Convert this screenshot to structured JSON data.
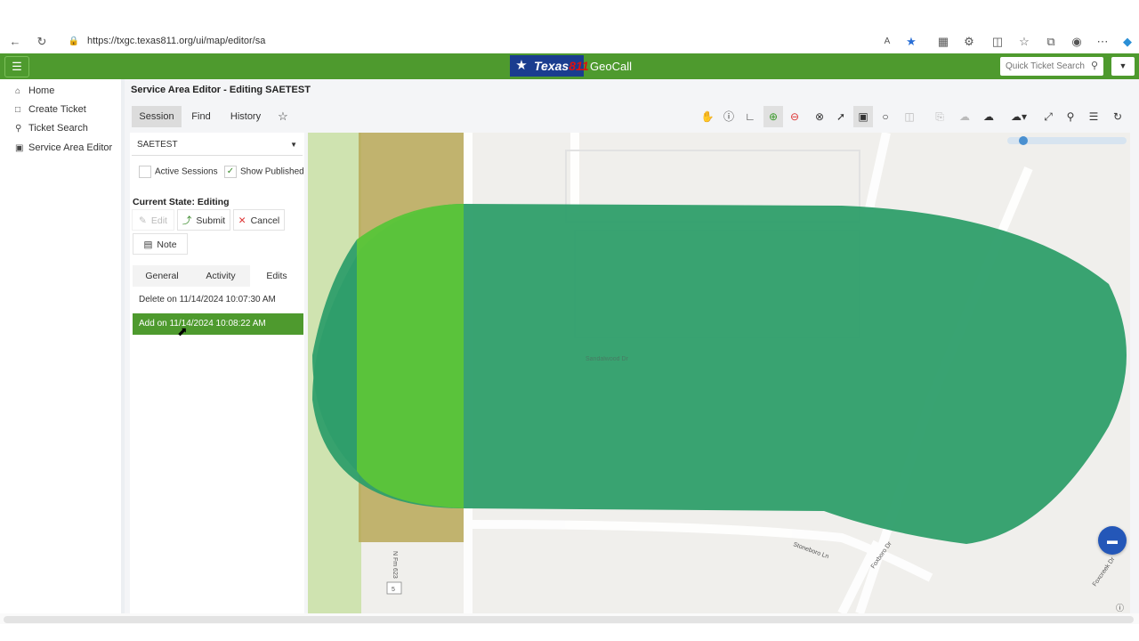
{
  "browser": {
    "url": "https://txgc.texas811.org/ui/map/editor/sa"
  },
  "app": {
    "logo_text": "Texas",
    "logo_number": "811",
    "title": "GeoCall",
    "quick_search_placeholder": "Quick Ticket Search",
    "brand_color": "#4e9a2e"
  },
  "sidebar": {
    "items": [
      {
        "label": "Home",
        "icon": "home-icon"
      },
      {
        "label": "Create Ticket",
        "icon": "document-icon"
      },
      {
        "label": "Ticket Search",
        "icon": "search-icon"
      },
      {
        "label": "Service Area Editor",
        "icon": "map-editor-icon"
      }
    ]
  },
  "editor": {
    "title": "Service Area Editor - Editing SAETEST",
    "tabs": [
      "Session",
      "Find",
      "History"
    ],
    "session_value": "SAETEST",
    "active_sessions_label": "Active Sessions",
    "show_published_label": "Show Published",
    "current_state": "Current State: Editing",
    "buttons": {
      "edit": "Edit",
      "submit": "Submit",
      "cancel": "Cancel",
      "note": "Note"
    },
    "subtabs": [
      "General",
      "Activity",
      "Edits"
    ],
    "edits": [
      "Delete on 11/14/2024 10:07:30 AM",
      "Add on 11/14/2024 10:08:22 AM"
    ]
  },
  "map": {
    "street_labels": [
      "Stoneboro Ln",
      "Foxboro Dr",
      "Foxcreek Dr",
      "Sandalwood Dr",
      "N Fm 623"
    ],
    "route_shield": "5",
    "polygon_color": "#2e9e6a",
    "added_area_color": "#5bc43a",
    "deleted_area_color": "#b8a858"
  }
}
